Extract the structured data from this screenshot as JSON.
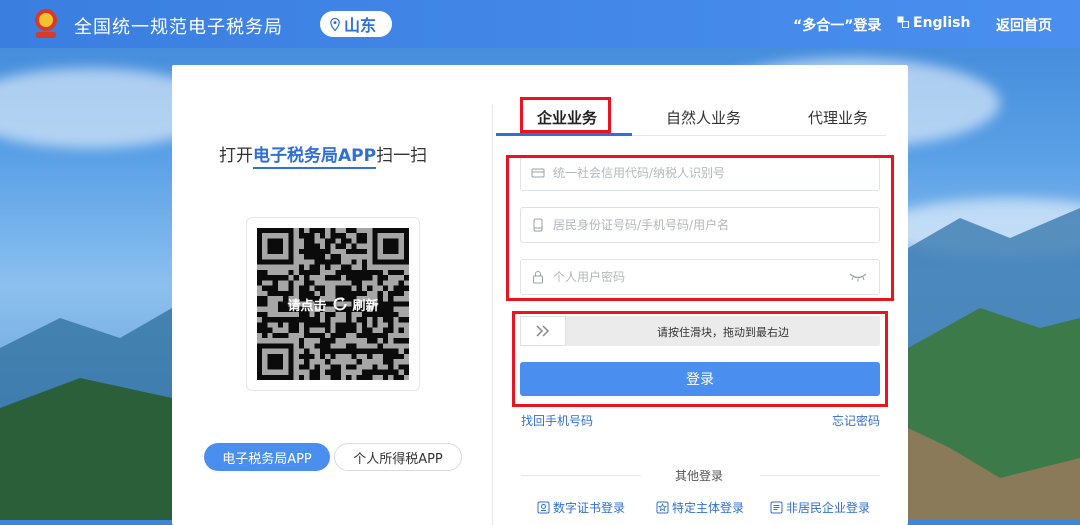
{
  "header": {
    "site_title": "全国统一规范电子税务局",
    "region": "山东",
    "multi_login": "“多合一”登录",
    "english": "English",
    "home": "返回首页"
  },
  "qr_panel": {
    "title_prefix": "打开",
    "title_highlight": "电子税务局APP",
    "title_suffix": "扫一扫",
    "refresh_prefix": "请点击",
    "refresh_suffix": "刷新",
    "apps": [
      "电子税务局APP",
      "个人所得税APP"
    ]
  },
  "tabs": [
    {
      "label": "企业业务",
      "active": true
    },
    {
      "label": "自然人业务",
      "active": false
    },
    {
      "label": "代理业务",
      "active": false
    }
  ],
  "form": {
    "credit_code_placeholder": "统一社会信用代码/纳税人识别号",
    "id_placeholder": "居民身份证号码/手机号码/用户名",
    "password_placeholder": "个人用户密码",
    "slider_text": "请按住滑块，拖动到最右边",
    "login_label": "登录",
    "recover_phone": "找回手机号码",
    "forgot_password": "忘记密码"
  },
  "other_login": {
    "title": "其他登录",
    "options": [
      "数字证书登录",
      "特定主体登录",
      "非居民企业登录"
    ]
  },
  "colors": {
    "brand_blue": "#4a8ff0",
    "link_blue": "#2f6fd6",
    "highlight_red": "#e8161c"
  }
}
